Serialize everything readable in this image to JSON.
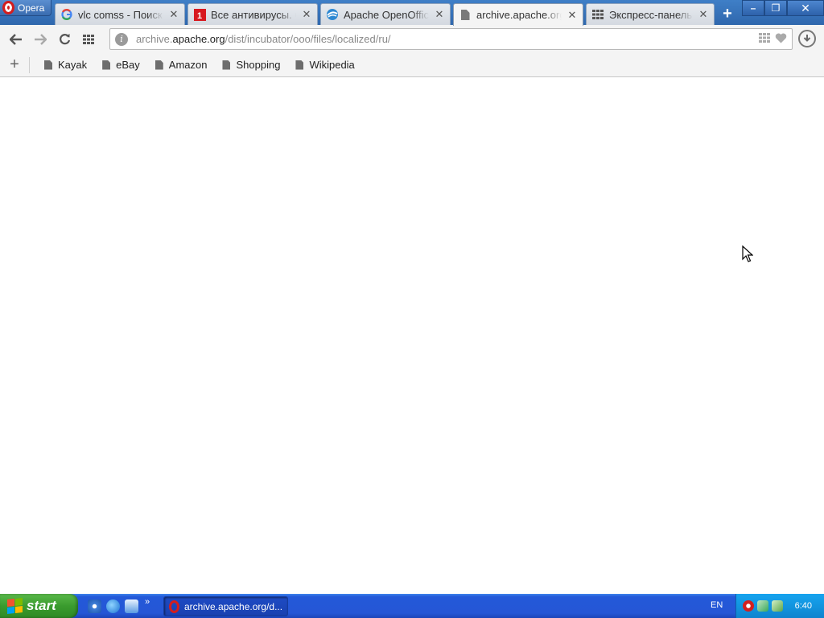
{
  "browser": {
    "menu_label": "Opera",
    "tabs": [
      {
        "label": "vlc comss - Поиск в Google",
        "favicon": "google-icon",
        "active": false
      },
      {
        "label": "Все антивирусы. Скачать",
        "favicon": "antivirus-icon",
        "active": false
      },
      {
        "label": "Apache OpenOffice",
        "favicon": "openoffice-icon",
        "active": false
      },
      {
        "label": "archive.apache.org/dist/incubator/ooo/files/localized/ru/",
        "favicon": "page-icon",
        "active": true
      },
      {
        "label": "Экспресс-панель",
        "favicon": "speed-dial-icon",
        "active": false
      }
    ],
    "new_tab_label": "+",
    "window_buttons": {
      "minimize": "–",
      "restore": "❐",
      "close": "✕"
    }
  },
  "toolbar": {
    "url_prefix": "archive.",
    "url_host": "apache.org",
    "url_path": "/dist/incubator/ooo/files/localized/ru/"
  },
  "bookmarks": {
    "add_label": "+",
    "items": [
      "Kayak",
      "eBay",
      "Amazon",
      "Shopping",
      "Wikipedia"
    ]
  },
  "taskbar": {
    "start_label": "start",
    "quick_launch_more": "»",
    "task_label": "archive.apache.org/d...",
    "language": "EN",
    "clock": "6:40"
  },
  "colors": {
    "taskbar_blue": "#2459d8",
    "start_green": "#3a9b2e",
    "opera_red": "#d31e1e",
    "tray_blue": "#1295df"
  }
}
